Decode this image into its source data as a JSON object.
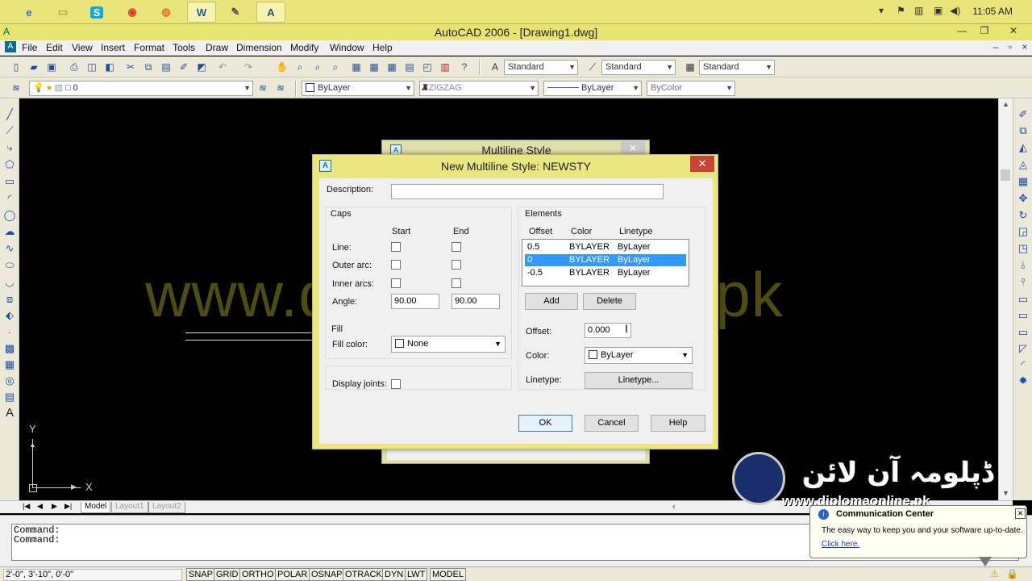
{
  "taskbar": {
    "clock": "11:05 AM",
    "apps": [
      "internet-explorer",
      "file-explorer",
      "skype",
      "chrome",
      "firefox",
      "word",
      "paint",
      "autocad"
    ]
  },
  "window": {
    "title": "AutoCAD 2006 - [Drawing1.dwg]"
  },
  "menu": [
    "File",
    "Edit",
    "View",
    "Insert",
    "Format",
    "Tools",
    "Draw",
    "Dimension",
    "Modify",
    "Window",
    "Help"
  ],
  "toolbar1": {
    "text_style": "Standard",
    "dim_style": "Standard",
    "table_style": "Standard"
  },
  "toolbar2": {
    "layer": "0",
    "color": "ByLayer",
    "linetype": "ZIGZAG",
    "lineweight": "ByLayer",
    "plotstyle": "ByColor"
  },
  "layout_tabs": [
    "Model",
    "Layout1",
    "Layout2"
  ],
  "watermark": "www.diplomaonline.pk",
  "command": {
    "line1": "Command:",
    "line2": "Command:"
  },
  "status": {
    "coords": "2'-0\",  3'-10\",  0'-0\"",
    "buttons": [
      "SNAP",
      "GRID",
      "ORTHO",
      "POLAR",
      "OSNAP",
      "OTRACK",
      "DYN",
      "LWT",
      "MODEL"
    ]
  },
  "bg_dialog": {
    "title": "Multiline Style"
  },
  "dialog": {
    "title": "New Multiline Style: NEWSTY",
    "description_label": "Description:",
    "description_value": "",
    "caps": {
      "label": "Caps",
      "start": "Start",
      "end": "End",
      "line": "Line:",
      "outer_arc": "Outer arc:",
      "inner_arc": "Inner arcs:",
      "angle": "Angle:",
      "angle_start": "90.00",
      "angle_end": "90.00"
    },
    "fill": {
      "label": "Fill",
      "fill_color_label": "Fill color:",
      "fill_color": "None"
    },
    "display_joints": "Display joints:",
    "elements": {
      "label": "Elements",
      "headers": [
        "Offset",
        "Color",
        "Linetype"
      ],
      "rows": [
        {
          "offset": "0.5",
          "color": "BYLAYER",
          "linetype": "ByLayer"
        },
        {
          "offset": "0",
          "color": "BYLAYER",
          "linetype": "ByLayer"
        },
        {
          "offset": "-0.5",
          "color": "BYLAYER",
          "linetype": "ByLayer"
        }
      ],
      "selected_row": 1,
      "add": "Add",
      "delete": "Delete",
      "offset_label": "Offset:",
      "offset_value": "0.000",
      "color_label": "Color:",
      "color_value": "ByLayer",
      "linetype_label": "Linetype:",
      "linetype_button": "Linetype..."
    },
    "ok": "OK",
    "cancel": "Cancel",
    "help": "Help"
  },
  "logo": {
    "name": "ڈپلومہ آن لائن",
    "url": "www.diplomaonline.pk"
  },
  "balloon": {
    "title": "Communication Center",
    "text": "The easy way to keep you and your software up-to-date.",
    "link": "Click here."
  },
  "colors": {
    "taskbar": "#e9e57a",
    "dialog_frame": "#ebe780",
    "selection": "#3399ff",
    "close_button": "#c94434"
  }
}
